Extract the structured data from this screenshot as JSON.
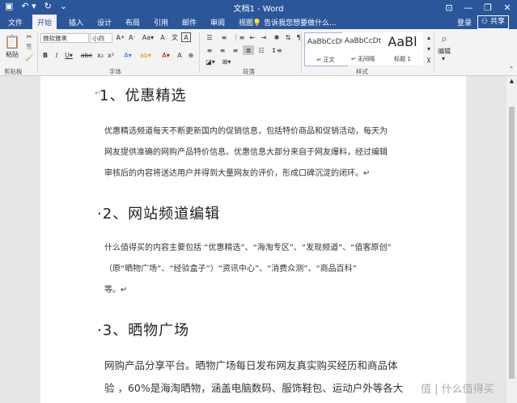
{
  "window": {
    "title": "文档1 - Word"
  },
  "tabs": [
    {
      "label": "文件"
    },
    {
      "label": "开始"
    },
    {
      "label": "插入"
    },
    {
      "label": "设计"
    },
    {
      "label": "布局"
    },
    {
      "label": "引用"
    },
    {
      "label": "邮件"
    },
    {
      "label": "审阅"
    },
    {
      "label": "视图"
    }
  ],
  "tell_me": "告诉我您想要做什么...",
  "login": "登录",
  "share": "共享",
  "ribbon": {
    "paste": "粘贴",
    "clipboard_label": "剪贴板",
    "font_name": "微软雅黑",
    "font_size": "小四",
    "font_label": "字体",
    "paragraph_label": "段落",
    "styles_label": "样式",
    "edit": "编辑",
    "styles": [
      {
        "preview": "AaBbCcDt",
        "name": "↵ 正文"
      },
      {
        "preview": "AaBbCcDt",
        "name": "↵ 无间隔"
      },
      {
        "preview": "AaBl",
        "name": "标题 1"
      }
    ]
  },
  "doc": {
    "h1": "1、优惠精选",
    "p1": [
      "优惠精选频道每天不断更新国内的促销信息，包括特价商品和促销活动，每天为",
      "网友提供准确的网购产品特价信息。优惠信息大部分来自于网友爆料，经过编辑",
      "审核后的内容将送达用户并得到大量网友的评价，形成口碑沉淀的闭环。↵"
    ],
    "h2": "·2、网站频道编辑",
    "p2": [
      "什么值得买的内容主要包括 “优惠精选”、“海淘专区”、“发现频道”、“值客原创”",
      "（原“晒物广场”、“经验盒子”）“资讯中心”、“消费众测”、“商品百科”",
      "等。↵"
    ],
    "h3": "·3、晒物广场",
    "p3": [
      "网购产品分享平台。晒物广场每日发布网友真实购买经历和商品体",
      "验 ，60%是海淘晒物，涵盖电脑数码、服饰鞋包、运动户外等各大"
    ]
  },
  "watermark": "值 | 什么值得买"
}
